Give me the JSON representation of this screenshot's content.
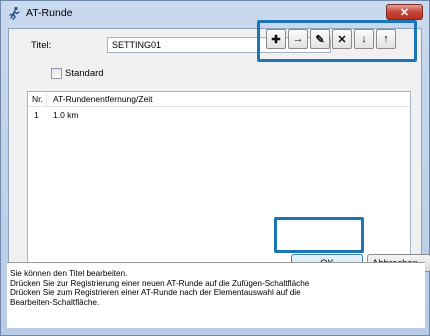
{
  "window": {
    "title": "AT-Runde",
    "close_glyph": "✕"
  },
  "form": {
    "titel_label": "Titel:",
    "titel_value": "SETTING01",
    "standard_label": "Standard"
  },
  "toolbar": {
    "buttons": [
      {
        "icon": "plus-icon",
        "glyph": "✚"
      },
      {
        "icon": "arrow-right-icon",
        "glyph": "→"
      },
      {
        "icon": "pencil-icon",
        "glyph": "✎"
      },
      {
        "icon": "delete-x-icon",
        "glyph": "✕"
      },
      {
        "icon": "arrow-down-icon",
        "glyph": "↓"
      },
      {
        "icon": "arrow-up-icon",
        "glyph": "↑"
      }
    ],
    "highlight_color": "#1a75b9"
  },
  "list": {
    "headers": [
      "Nr.",
      "AT-Rundenentfernung/Zeit"
    ],
    "rows": [
      {
        "nr": "1",
        "value": "1.0 km"
      }
    ]
  },
  "buttons": {
    "ok": "OK",
    "cancel": "Abbrechen"
  },
  "status": {
    "lines": [
      "Sie können den Titel bearbeiten.",
      "Drücken Sie zur Registrierung einer neuen AT-Runde auf die Zufügen-Schaltfläche",
      "Drücken Sie zum Registrieren einer AT-Runde nach der Elementauswahl auf die",
      "Bearbeiten-Schaltfläche."
    ]
  }
}
